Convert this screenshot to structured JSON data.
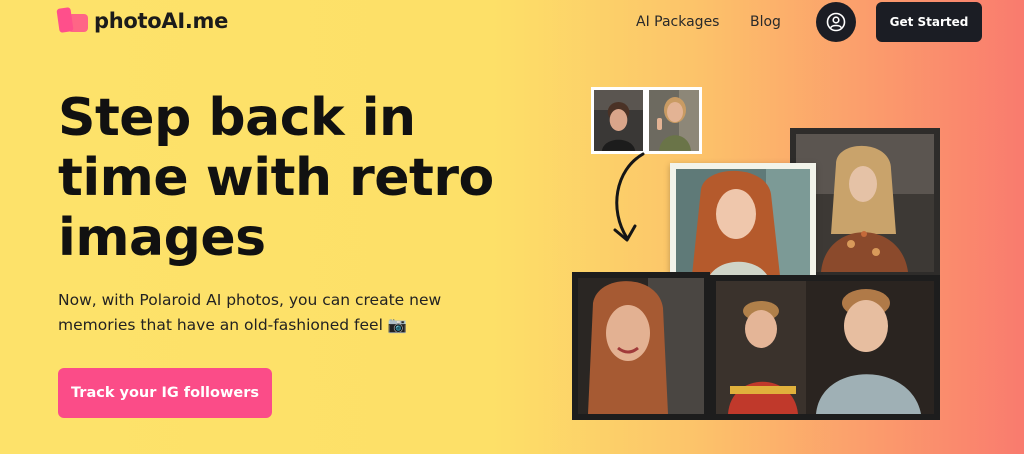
{
  "header": {
    "logo_text": "photoAI.me",
    "nav": [
      {
        "label": "AI Packages"
      },
      {
        "label": "Blog"
      }
    ],
    "cta_label": "Get Started"
  },
  "hero": {
    "headline_lines": [
      "Step back in",
      "time with retro",
      "images"
    ],
    "subtext_line1": "Now, with Polaroid AI photos, you can create new",
    "subtext_line2": "memories that have an old-fashioned feel 📷",
    "cta_label": "Track your IG followers"
  },
  "colors": {
    "accent": "#fb4c88",
    "dark": "#1b1d24",
    "bg_start": "#fde26a",
    "bg_end": "#f97b6e"
  }
}
